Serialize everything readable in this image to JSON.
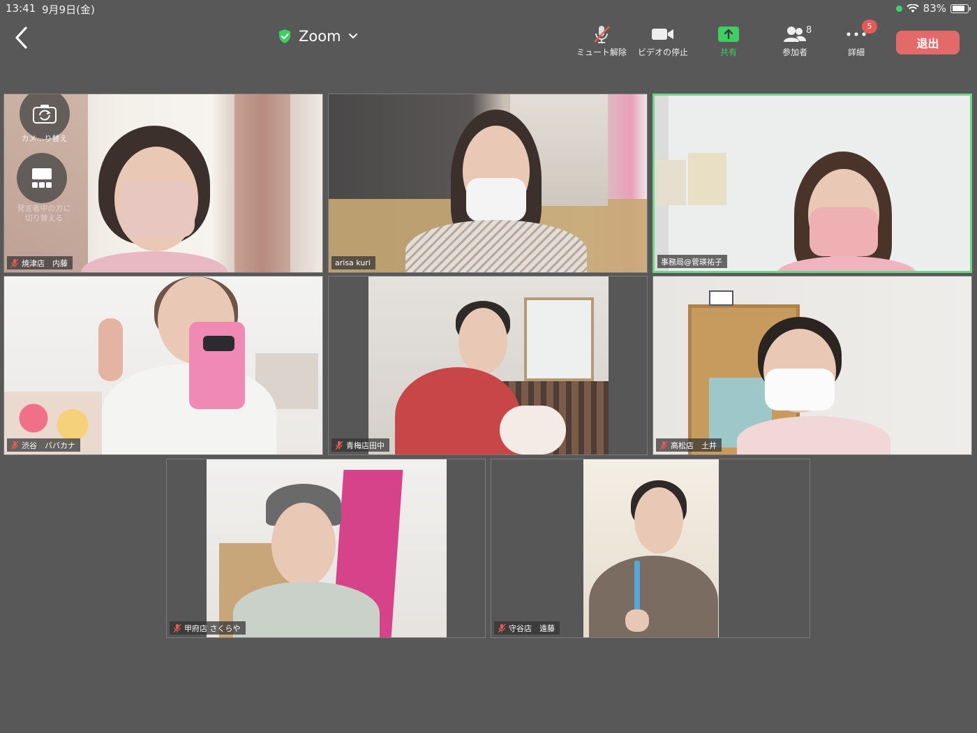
{
  "status_bar": {
    "time": "13:41",
    "date": "9月9日(金)",
    "battery": "83%",
    "battery_level": 0.83
  },
  "header": {
    "title": "Zoom",
    "tools": [
      {
        "label": "ミュート解除",
        "icon": "mic-muted-icon"
      },
      {
        "label": "ビデオの停止",
        "icon": "video-camera-icon"
      },
      {
        "label": "共有",
        "icon": "share-screen-icon"
      },
      {
        "label": "参加者",
        "icon": "participants-icon",
        "count": "8"
      },
      {
        "label": "詳細",
        "icon": "more-icon",
        "badge": "5"
      }
    ],
    "leave_label": "退出"
  },
  "camera_overlay": {
    "switch_camera_label": "カメ…り替え",
    "switch_view_label": "発言者中の方に 切り替える"
  },
  "participants": [
    {
      "name": "焼津店　内藤",
      "muted": true
    },
    {
      "name": "arisa kuri",
      "muted": false
    },
    {
      "name": "事務局@菅瑛祐子",
      "muted": false,
      "active": true
    },
    {
      "name": "渋谷　ババカナ",
      "muted": true
    },
    {
      "name": "青梅店田中",
      "muted": true
    },
    {
      "name": "高松店　土井",
      "muted": true
    },
    {
      "name": "甲府店 さくらや",
      "muted": true
    },
    {
      "name": "守谷店　遠藤",
      "muted": true
    }
  ],
  "colors": {
    "background": "#585858",
    "leave_button": "#e36a68",
    "active_speaker_border": "#6fd689",
    "share_green": "#3ecf62",
    "badge_red": "#e65a58"
  }
}
